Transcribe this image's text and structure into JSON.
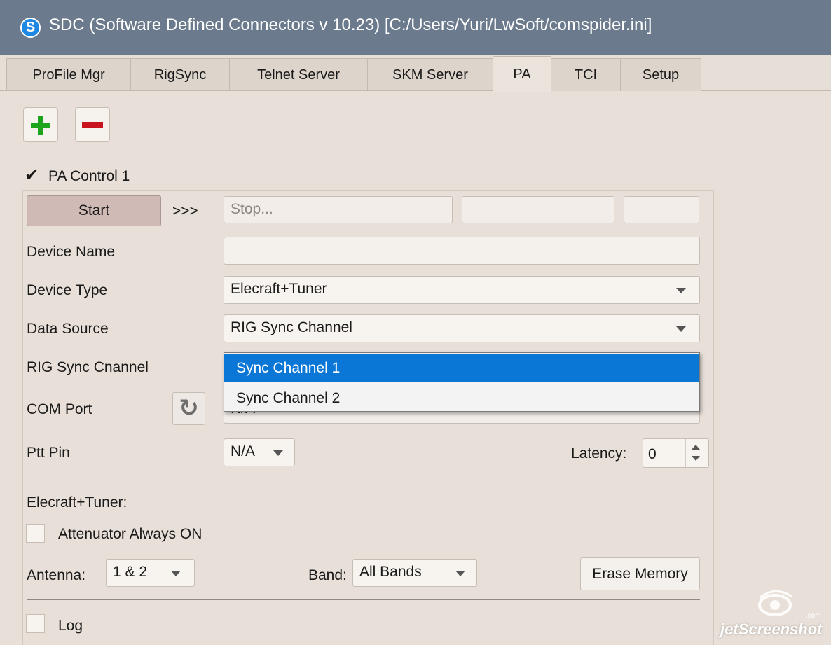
{
  "window": {
    "title": "SDC (Software Defined Connectors v 10.23) [C:/Users/Yuri/LwSoft/comspider.ini]",
    "app_icon_glyph": "S"
  },
  "tabs": [
    {
      "label": "ProFile Mgr",
      "active": false
    },
    {
      "label": "RigSync",
      "active": false
    },
    {
      "label": "Telnet Server",
      "active": false
    },
    {
      "label": "SKM Server",
      "active": false
    },
    {
      "label": "PA",
      "active": true
    },
    {
      "label": "TCI",
      "active": false
    },
    {
      "label": "Setup",
      "active": false
    }
  ],
  "toolbar": {
    "add_icon": "plus-icon",
    "remove_icon": "minus-icon"
  },
  "pa": {
    "check_mark": "✔",
    "enable_label": "PA Control 1",
    "start_label": "Start",
    "arrows": ">>>",
    "status_placeholder": "Stop...",
    "device_name_label": "Device Name",
    "device_name_value": "",
    "device_type_label": "Device Type",
    "device_type_value": "Elecraft+Tuner",
    "data_source_label": "Data Source",
    "data_source_value": "RIG Sync Channel",
    "rig_sync_label": "RIG Sync Cnannel",
    "com_port_label": "COM Port",
    "com_port_value": "N/A",
    "ptt_label": "Ptt Pin",
    "ptt_value": "N/A",
    "latency_label": "Latency:",
    "latency_value": "0",
    "section_title": "Elecraft+Tuner:",
    "attenuator_label": "Attenuator Always ON",
    "antenna_label": "Antenna:",
    "antenna_value": "1 & 2",
    "band_label": "Band:",
    "band_value": "All Bands",
    "erase_label": "Erase Memory",
    "log_label": "Log"
  },
  "dropdown": {
    "options": [
      "Sync Channel 1",
      "Sync Channel 2"
    ],
    "selected_index": 0
  },
  "watermark": {
    "text": "jetScreenshot",
    "small": ".com"
  },
  "colors": {
    "titlebar": "#6b7b8d",
    "selection": "#0a77d6",
    "add_green": "#1ca51c",
    "remove_red": "#c8141e",
    "start_button": "#cfbab6"
  }
}
